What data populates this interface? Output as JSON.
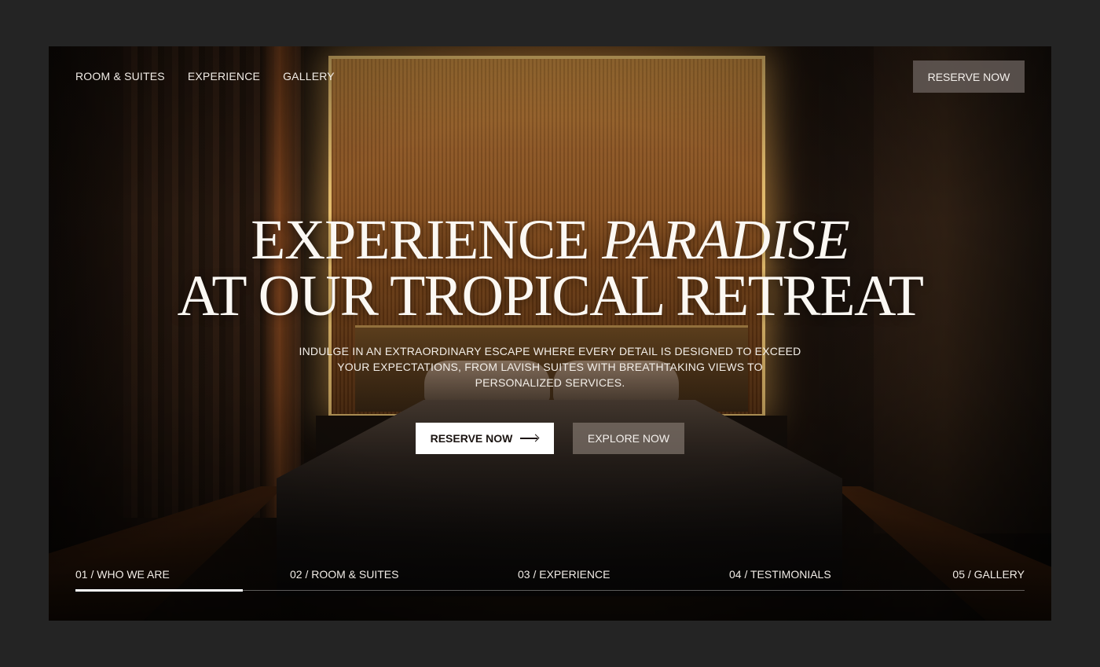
{
  "nav": {
    "links": [
      "ROOM & SUITES",
      "EXPERIENCE",
      "GALLERY"
    ],
    "reserve_label": "RESERVE NOW"
  },
  "hero": {
    "title_part1": "EXPERIENCE ",
    "title_italic": "PARADISE",
    "title_line2": "AT OUR TROPICAL RETREAT",
    "subtitle": "INDULGE IN AN EXTRAORDINARY ESCAPE WHERE EVERY DETAIL IS DESIGNED TO EXCEED YOUR EXPECTATIONS, FROM LAVISH SUITES WITH BREATHTAKING VIEWS TO PERSONALIZED SERVICES.",
    "primary_button": "RESERVE NOW",
    "secondary_button": "EXPLORE NOW"
  },
  "sections": {
    "tabs": [
      "01 / WHO WE ARE",
      "02 / ROOM & SUITES",
      "03 / EXPERIENCE",
      "04 / TESTIMONIALS",
      "05 / GALLERY"
    ],
    "active_index": 0,
    "progress_fraction": 0.176
  },
  "colors": {
    "page_bg": "#242424",
    "accent_light": "#ffffff",
    "button_translucent": "#6e6460"
  }
}
